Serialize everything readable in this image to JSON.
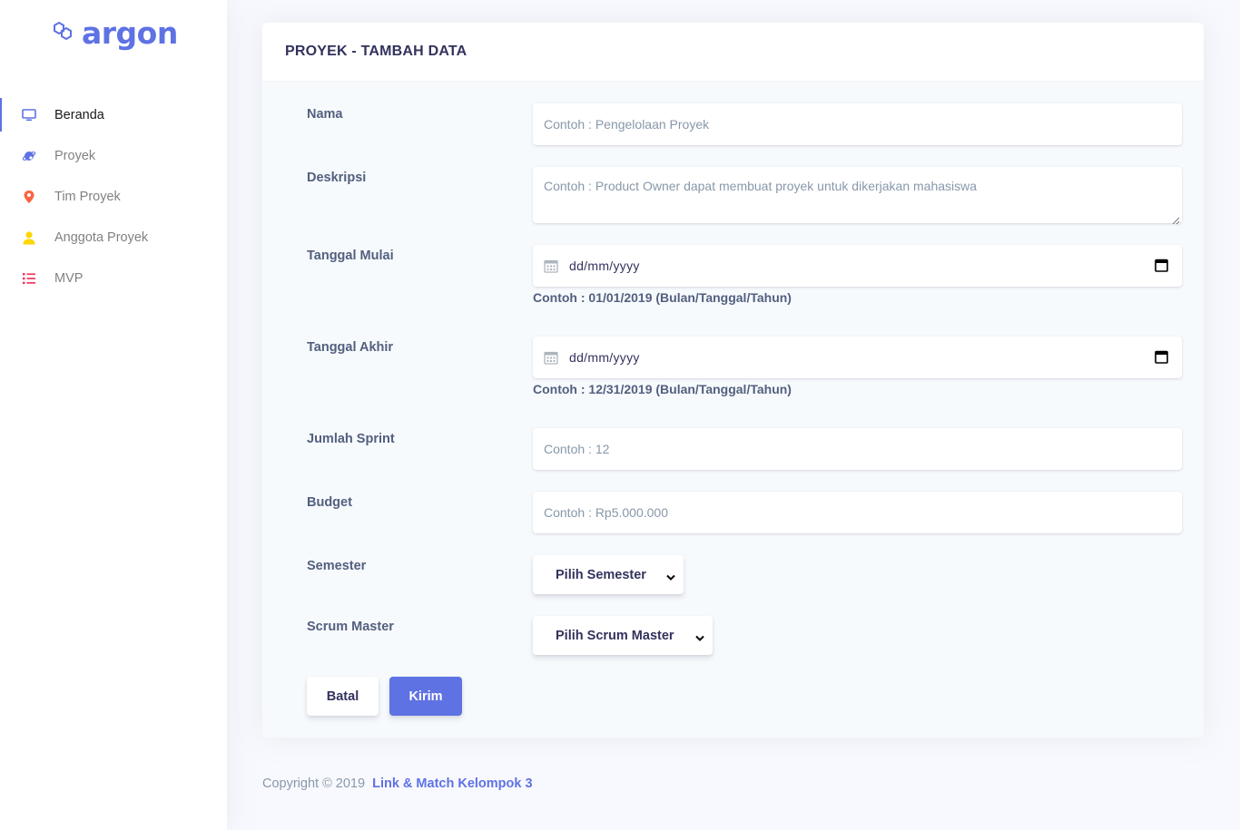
{
  "brand": {
    "name": "argon",
    "icon": "hexagons-logo-icon"
  },
  "sidebar": {
    "items": [
      {
        "label": "Beranda",
        "icon": "tv-icon",
        "color": "#5e72e4",
        "active": true
      },
      {
        "label": "Proyek",
        "icon": "planet-icon",
        "color": "#5e72e4",
        "active": false
      },
      {
        "label": "Tim Proyek",
        "icon": "pin-icon",
        "color": "#fb6340",
        "active": false
      },
      {
        "label": "Anggota Proyek",
        "icon": "user-icon",
        "color": "#ffd600",
        "active": false
      },
      {
        "label": "MVP",
        "icon": "list-icon",
        "color": "#f5365c",
        "active": false
      }
    ]
  },
  "card": {
    "title": "PROYEK - TAMBAH DATA"
  },
  "form": {
    "nama": {
      "label": "Nama",
      "placeholder": "Contoh : Pengelolaan Proyek",
      "value": ""
    },
    "deskripsi": {
      "label": "Deskripsi",
      "placeholder": "Contoh : Product Owner dapat membuat proyek untuk dikerjakan mahasiswa",
      "value": ""
    },
    "tanggal_mulai": {
      "label": "Tanggal Mulai",
      "value": "dd/mm/yyyy",
      "hint": "Contoh : 01/01/2019 (Bulan/Tanggal/Tahun)"
    },
    "tanggal_akhir": {
      "label": "Tanggal Akhir",
      "value": "dd/mm/yyyy",
      "hint": "Contoh : 12/31/2019 (Bulan/Tanggal/Tahun)"
    },
    "jumlah_sprint": {
      "label": "Jumlah Sprint",
      "placeholder": "Contoh : 12",
      "value": ""
    },
    "budget": {
      "label": "Budget",
      "placeholder": "Contoh : Rp5.000.000",
      "value": ""
    },
    "semester": {
      "label": "Semester",
      "selected": "Pilih Semester"
    },
    "scrum_master": {
      "label": "Scrum Master",
      "selected": "Pilih Scrum Master"
    }
  },
  "buttons": {
    "cancel": "Batal",
    "submit": "Kirim"
  },
  "footer": {
    "copyright": "Copyright © 2019",
    "link": "Link & Match Kelompok 3"
  },
  "colors": {
    "primary": "#5e72e4",
    "heading": "#32325d",
    "text": "#525f7f",
    "muted": "#8898aa"
  }
}
